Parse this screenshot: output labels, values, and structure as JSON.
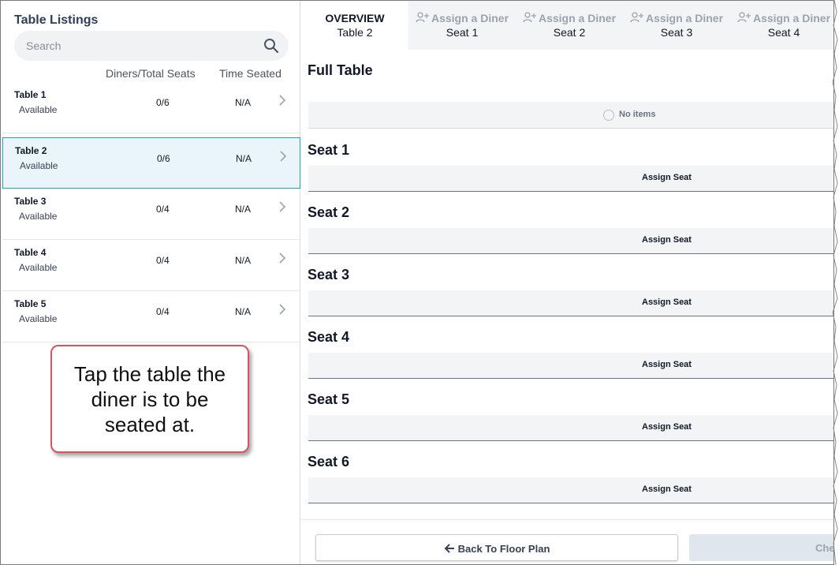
{
  "left_panel": {
    "title": "Table Listings",
    "search_placeholder": "Search",
    "columns": {
      "diners": "Diners/Total Seats",
      "time": "Time Seated"
    },
    "tables": [
      {
        "name": "Table 1",
        "status": "Available",
        "seats": "0/6",
        "time": "N/A",
        "selected": false
      },
      {
        "name": "Table 2",
        "status": "Available",
        "seats": "0/6",
        "time": "N/A",
        "selected": true
      },
      {
        "name": "Table 3",
        "status": "Available",
        "seats": "0/4",
        "time": "N/A",
        "selected": false
      },
      {
        "name": "Table 4",
        "status": "Available",
        "seats": "0/4",
        "time": "N/A",
        "selected": false
      },
      {
        "name": "Table 5",
        "status": "Available",
        "seats": "0/4",
        "time": "N/A",
        "selected": false
      }
    ]
  },
  "callout": {
    "text": "Tap the table the diner is to be seated at."
  },
  "tabs": [
    {
      "line1": "OVERVIEW",
      "line2": "Table 2",
      "icon": ""
    },
    {
      "line1": "Assign a Diner",
      "line2": "Seat 1",
      "icon": "add-user-icon"
    },
    {
      "line1": "Assign a Diner",
      "line2": "Seat 2",
      "icon": "add-user-icon"
    },
    {
      "line1": "Assign a Diner",
      "line2": "Seat 3",
      "icon": "add-user-icon"
    },
    {
      "line1": "Assign a Diner",
      "line2": "Seat 4",
      "icon": "add-user-icon"
    }
  ],
  "overview": {
    "full_table_title": "Full Table",
    "empty_text": "No items",
    "seats": [
      {
        "title": "Seat 1",
        "button": "Assign Seat"
      },
      {
        "title": "Seat 2",
        "button": "Assign Seat"
      },
      {
        "title": "Seat 3",
        "button": "Assign Seat"
      },
      {
        "title": "Seat 4",
        "button": "Assign Seat"
      },
      {
        "title": "Seat 5",
        "button": "Assign Seat"
      },
      {
        "title": "Seat 6",
        "button": "Assign Seat"
      }
    ]
  },
  "footer": {
    "back_label": "Back To Floor Plan",
    "checkin_label": "Che"
  },
  "colors": {
    "selected_row_bg": "#eaf4fb",
    "selected_row_border": "#2a9db8",
    "callout_border": "#d9535f",
    "title_color": "#2f3e5a"
  }
}
